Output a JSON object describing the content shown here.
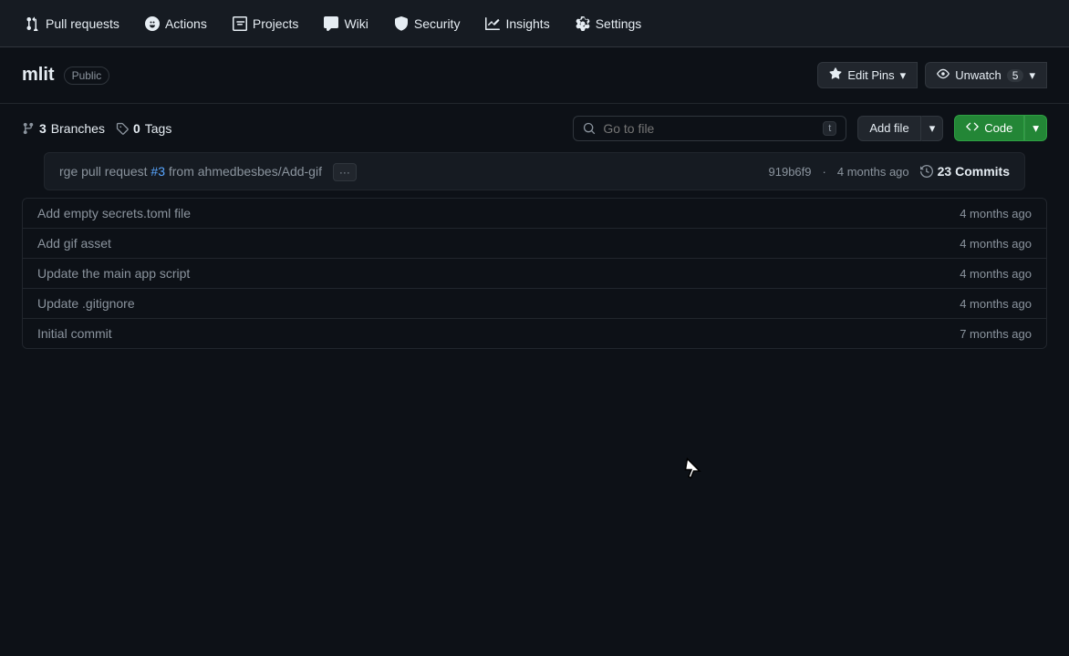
{
  "nav": {
    "items": [
      {
        "id": "pull-requests",
        "label": "Pull requests",
        "icon": "pr-icon"
      },
      {
        "id": "actions",
        "label": "Actions",
        "icon": "actions-icon"
      },
      {
        "id": "projects",
        "label": "Projects",
        "icon": "projects-icon"
      },
      {
        "id": "wiki",
        "label": "Wiki",
        "icon": "wiki-icon"
      },
      {
        "id": "security",
        "label": "Security",
        "icon": "security-icon"
      },
      {
        "id": "insights",
        "label": "Insights",
        "icon": "insights-icon"
      },
      {
        "id": "settings",
        "label": "Settings",
        "icon": "settings-icon"
      }
    ]
  },
  "repo": {
    "name": "mlit",
    "visibility": "Public",
    "edit_pins_label": "Edit Pins",
    "unwatch_label": "Unwatch",
    "unwatch_count": "5"
  },
  "file_nav": {
    "branches_count": "3",
    "branches_label": "Branches",
    "tags_count": "0",
    "tags_label": "Tags",
    "search_placeholder": "Go to file",
    "search_kbd": "t",
    "add_file_label": "Add file",
    "code_label": "Code"
  },
  "commit": {
    "message_prefix": "rge pull request ",
    "pr_link": "#3",
    "message_suffix": " from ahmedbesbes/Add-gif",
    "hash": "919b6f9",
    "time": "4 months ago",
    "commits_count": "23 Commits"
  },
  "files": [
    {
      "name": "",
      "commit_msg": "Add empty secrets.toml file",
      "time": "4 months ago"
    },
    {
      "name": "",
      "commit_msg": "Add gif asset",
      "time": "4 months ago"
    },
    {
      "name": "",
      "commit_msg": "Update the main app script",
      "time": "4 months ago"
    },
    {
      "name": "",
      "commit_msg": "Update .gitignore",
      "time": "4 months ago"
    },
    {
      "name": "",
      "commit_msg": "Initial commit",
      "time": "7 months ago"
    }
  ],
  "colors": {
    "accent_blue": "#58a6ff",
    "accent_green": "#238636",
    "pr_link_color": "#58a6ff"
  }
}
